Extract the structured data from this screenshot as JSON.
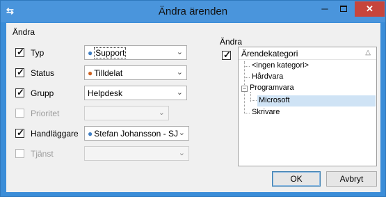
{
  "window": {
    "title": "Ändra ärenden",
    "icon": "app-icon",
    "min_glyph": "─",
    "close_glyph": "✕"
  },
  "left": {
    "section_label": "Ändra",
    "rows": [
      {
        "label": "Typ",
        "checked": true,
        "enabled": true,
        "value": "Support",
        "icon": "person-icon"
      },
      {
        "label": "Status",
        "checked": true,
        "enabled": true,
        "value": "Tilldelat",
        "icon": "status-icon"
      },
      {
        "label": "Grupp",
        "checked": true,
        "enabled": true,
        "value": "Helpdesk",
        "icon": ""
      },
      {
        "label": "Prioritet",
        "checked": false,
        "enabled": false,
        "value": "",
        "icon": ""
      },
      {
        "label": "Handläggare",
        "checked": true,
        "enabled": true,
        "value": "Stefan Johansson - SJ",
        "icon": "person-icon"
      },
      {
        "label": "Tjänst",
        "checked": false,
        "enabled": false,
        "value": "",
        "icon": ""
      }
    ]
  },
  "right": {
    "section_label": "Ändra",
    "checked": true,
    "tree": {
      "header": "Ärendekategori",
      "sort_glyph": "△",
      "items": [
        {
          "label": "<ingen kategori>",
          "level": 1,
          "expander": ""
        },
        {
          "label": "Hårdvara",
          "level": 1,
          "expander": ""
        },
        {
          "label": "Programvara",
          "level": 0,
          "expander": "⊟"
        },
        {
          "label": "Microsoft",
          "level": 2,
          "expander": "",
          "selected": true
        },
        {
          "label": "Skrivare",
          "level": 1,
          "expander": ""
        }
      ]
    }
  },
  "buttons": {
    "ok": "OK",
    "cancel": "Avbryt"
  },
  "glyphs": {
    "check": "✓",
    "combo_arrow": "⌄",
    "person": "👤",
    "status": "👤"
  }
}
